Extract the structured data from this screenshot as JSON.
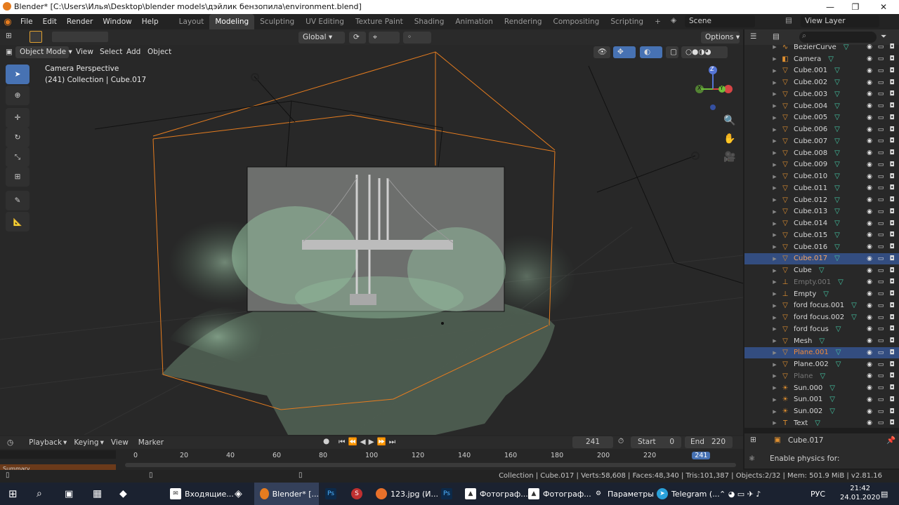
{
  "window": {
    "title": "Blender* [C:\\Users\\Илья\\Desktop\\blender models\\дэйлик бензопила\\environment.blend]",
    "min": "—",
    "max": "❐",
    "close": "✕"
  },
  "menu": [
    "File",
    "Edit",
    "Render",
    "Window",
    "Help"
  ],
  "workspaces": [
    "Layout",
    "Modeling",
    "Sculpting",
    "UV Editing",
    "Texture Paint",
    "Shading",
    "Animation",
    "Rendering",
    "Compositing",
    "Scripting"
  ],
  "active_workspace": "Modeling",
  "scene": {
    "label": "Scene",
    "view_layer": "View Layer"
  },
  "toolbar": {
    "orientation": "Global",
    "options": "Options"
  },
  "viewport_header": {
    "mode": "Object Mode",
    "menus": [
      "View",
      "Select",
      "Add",
      "Object"
    ]
  },
  "viewport": {
    "view_name": "Camera Perspective",
    "collection_info": "(241) Collection | Cube.017",
    "gizmo": {
      "x": "X",
      "y": "Y",
      "z": "Z"
    }
  },
  "outliner": {
    "items": [
      {
        "name": "BezierCurve",
        "icon": "curve-icon",
        "selected": false,
        "dim": false
      },
      {
        "name": "Camera",
        "icon": "camera-icon",
        "selected": false,
        "dim": false
      },
      {
        "name": "Cube.001",
        "icon": "mesh-icon",
        "selected": false,
        "dim": false
      },
      {
        "name": "Cube.002",
        "icon": "mesh-icon",
        "selected": false,
        "dim": false
      },
      {
        "name": "Cube.003",
        "icon": "mesh-icon",
        "selected": false,
        "dim": false
      },
      {
        "name": "Cube.004",
        "icon": "mesh-icon",
        "selected": false,
        "dim": false
      },
      {
        "name": "Cube.005",
        "icon": "mesh-icon",
        "selected": false,
        "dim": false
      },
      {
        "name": "Cube.006",
        "icon": "mesh-icon",
        "selected": false,
        "dim": false
      },
      {
        "name": "Cube.007",
        "icon": "mesh-icon",
        "selected": false,
        "dim": false
      },
      {
        "name": "Cube.008",
        "icon": "mesh-icon",
        "selected": false,
        "dim": false
      },
      {
        "name": "Cube.009",
        "icon": "mesh-icon",
        "selected": false,
        "dim": false
      },
      {
        "name": "Cube.010",
        "icon": "mesh-icon",
        "selected": false,
        "dim": false
      },
      {
        "name": "Cube.011",
        "icon": "mesh-icon",
        "selected": false,
        "dim": false
      },
      {
        "name": "Cube.012",
        "icon": "mesh-icon",
        "selected": false,
        "dim": false
      },
      {
        "name": "Cube.013",
        "icon": "mesh-icon",
        "selected": false,
        "dim": false
      },
      {
        "name": "Cube.014",
        "icon": "mesh-icon",
        "selected": false,
        "dim": false
      },
      {
        "name": "Cube.015",
        "icon": "mesh-icon",
        "selected": false,
        "dim": false
      },
      {
        "name": "Cube.016",
        "icon": "mesh-icon",
        "selected": false,
        "dim": false
      },
      {
        "name": "Cube.017",
        "icon": "mesh-icon",
        "selected": true,
        "dim": false
      },
      {
        "name": "Cube",
        "icon": "mesh-icon",
        "selected": false,
        "dim": false
      },
      {
        "name": "Empty.001",
        "icon": "empty-icon",
        "selected": false,
        "dim": true
      },
      {
        "name": "Empty",
        "icon": "empty-icon",
        "selected": false,
        "dim": false
      },
      {
        "name": "ford focus.001",
        "icon": "mesh-icon",
        "selected": false,
        "dim": false
      },
      {
        "name": "ford focus.002",
        "icon": "mesh-icon",
        "selected": false,
        "dim": false
      },
      {
        "name": "ford focus",
        "icon": "mesh-icon",
        "selected": false,
        "dim": false
      },
      {
        "name": "Mesh",
        "icon": "mesh-icon",
        "selected": false,
        "dim": false
      },
      {
        "name": "Plane.001",
        "icon": "mesh-icon",
        "selected": true,
        "dim": false
      },
      {
        "name": "Plane.002",
        "icon": "mesh-icon",
        "selected": false,
        "dim": false
      },
      {
        "name": "Plane",
        "icon": "mesh-icon",
        "selected": false,
        "dim": true
      },
      {
        "name": "Sun.000",
        "icon": "light-icon",
        "selected": false,
        "dim": false
      },
      {
        "name": "Sun.001",
        "icon": "light-icon",
        "selected": false,
        "dim": false
      },
      {
        "name": "Sun.002",
        "icon": "light-icon",
        "selected": false,
        "dim": false
      },
      {
        "name": "Text",
        "icon": "text-icon",
        "selected": false,
        "dim": false
      }
    ]
  },
  "properties": {
    "object": "Cube.017",
    "physics_label": "Enable physics for:"
  },
  "timeline": {
    "menus": [
      "Playback",
      "Keying",
      "View",
      "Marker"
    ],
    "current_frame": "241",
    "start_label": "Start",
    "start": "0",
    "end_label": "End",
    "end": "220",
    "ticks": [
      "0",
      "20",
      "40",
      "60",
      "80",
      "100",
      "120",
      "140",
      "160",
      "180",
      "200",
      "220",
      "241"
    ],
    "summary": "Summary"
  },
  "status": "Collection | Cube.017 | Verts:58,608 | Faces:48,340 | Tris:101,387 | Objects:2/32 | Mem: 501.9 MiB | v2.81.16",
  "taskbar": {
    "items": [
      "Входящие...",
      "Blender* [...",
      "123.jpg (И...",
      "Фотограф...",
      "Фотограф...",
      "Параметры",
      "Telegram (..."
    ],
    "lang": "РУС",
    "time": "21:42",
    "date": "24.01.2020"
  },
  "colors": {
    "accent": "#e57c1f",
    "selected": "#334d80",
    "mint": "#8fb79a"
  }
}
